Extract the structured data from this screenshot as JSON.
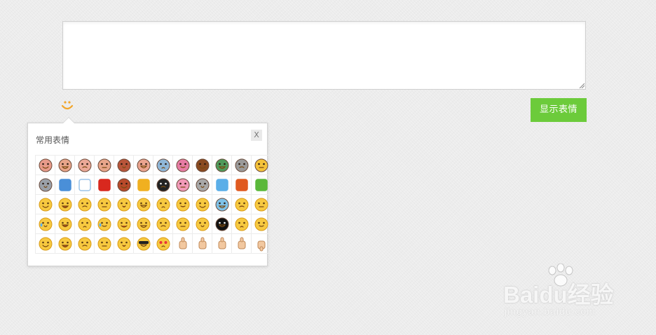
{
  "composer": {
    "value": "",
    "placeholder": ""
  },
  "toolbar": {
    "show_emoji_label": "显示表情",
    "smiley_icon": "smiley-icon"
  },
  "emoji_panel": {
    "title": "常用表情",
    "close_label": "X",
    "emojis": [
      "baby-tantrum",
      "baby-hehe",
      "baby-crying",
      "baby-wave",
      "lion-face",
      "baby-shy",
      "bus-face",
      "rabbit-face",
      "brown-hair-girl",
      "green-face",
      "robot-99",
      "yellow-cat",
      "bear-face",
      "shen-char",
      "cloud",
      "red-envelope",
      "little-man",
      "down-arrow",
      "panda",
      "pink-pig",
      "ultraman",
      "sweet-char",
      "world-cup",
      "gift-box",
      "smile",
      "grin",
      "laugh",
      "happy",
      "shy",
      "worried",
      "surprised",
      "cheeky",
      "cute",
      "blue-face-sad",
      "doubt",
      "thinking",
      "cry",
      "think",
      "shocked",
      "sweat",
      "embarrassed",
      "confused",
      "wink",
      "kiss",
      "frown",
      "black-face",
      "angry",
      "annoyed",
      "sly",
      "whisper",
      "blush",
      "speechless",
      "money",
      "cool",
      "heart-eyes",
      "ok-hand",
      "thumb-fist",
      "point-up",
      "thumbs-up",
      "thumbs-down"
    ]
  },
  "watermark": {
    "brand": "Baidu经验",
    "url": "jingyan.baidu.com"
  },
  "colors": {
    "accent_green": "#6ccb3b",
    "smiley_orange": "#f2a62b",
    "background": "#ececec"
  }
}
